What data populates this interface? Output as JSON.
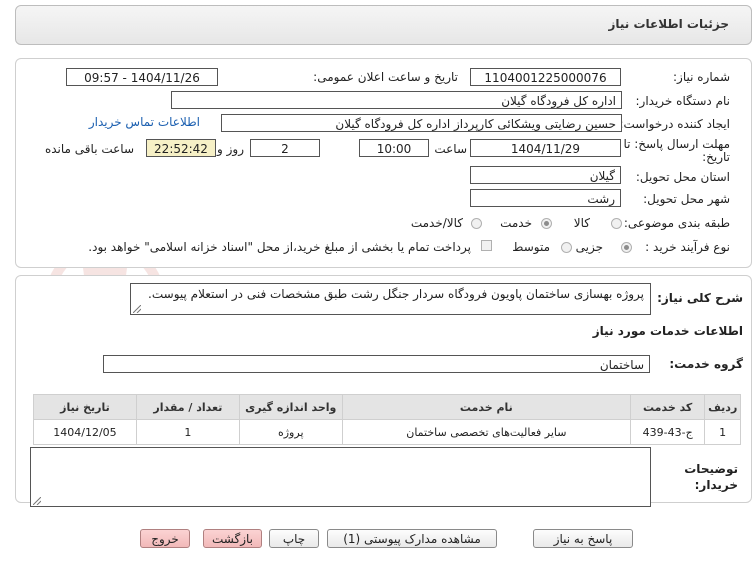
{
  "header": {
    "title": "جزئیات اطلاعات نیاز"
  },
  "watermark": {
    "text": "AriaTender.net"
  },
  "fields": {
    "need_number_label": "شماره نیاز:",
    "need_number": "1104001225000076",
    "announce_label": "تاریخ و ساعت اعلان عمومی:",
    "announce_value": "1404/11/26 - 09:57",
    "buyer_org_label": "نام دستگاه خریدار:",
    "buyer_org": "اداره کل فرودگاه گیلان",
    "creator_label": "ایجاد کننده درخواست:",
    "creator": "حسین رضایتی ویشکائی کارپرداز اداره کل فرودگاه گیلان",
    "contact_link": "اطلاعات تماس خریدار",
    "deadline_label_1": "مهلت ارسال پاسخ: تا",
    "deadline_label_2": "تاریخ:",
    "deadline_date": "1404/11/29",
    "time_label": "ساعت",
    "deadline_time": "10:00",
    "days_value": "2",
    "days_label": "روز و",
    "remaining_time": "22:52:42",
    "remaining_label": "ساعت باقی مانده",
    "province_label": "استان محل تحویل:",
    "province": "گیلان",
    "city_label": "شهر محل تحویل:",
    "city": "رشت",
    "category_label": "طبقه بندی موضوعی:",
    "category_options": [
      "کالا",
      "خدمت",
      "کالا/خدمت"
    ],
    "category_selected": "خدمت",
    "process_label": "نوع فرآیند خرید :",
    "process_options": [
      "جزیی",
      "متوسط"
    ],
    "process_selected": "جزیی",
    "payment_note": "پرداخت تمام یا بخشی از مبلغ خرید،از محل \"اسناد خزانه اسلامی\" خواهد بود."
  },
  "description": {
    "label": "شرح کلی نیاز:",
    "text": "پروژه بهسازی ساختمان پاویون فرودگاه سردار جنگل رشت طبق مشخصات فنی در استعلام پیوست."
  },
  "services": {
    "section_title": "اطلاعات خدمات مورد نیاز",
    "group_label": "گروه خدمت:",
    "group_value": "ساختمان",
    "columns": [
      "ردیف",
      "کد خدمت",
      "نام خدمت",
      "واحد اندازه گیری",
      "تعداد / مقدار",
      "تاریخ نیاز"
    ],
    "rows": [
      [
        "1",
        "ج-43-439",
        "سایر فعالیت‌های تخصصی ساختمان",
        "پروژه",
        "1",
        "1404/12/05"
      ]
    ]
  },
  "buyer_notes": {
    "label_1": "توضیحات",
    "label_2": "خریدار:",
    "text": ""
  },
  "buttons": {
    "reply": "پاسخ به نیاز",
    "attachments": "مشاهده مدارک پیوستی (1)",
    "print": "چاپ",
    "back": "بازگشت",
    "exit": "خروج"
  },
  "colors": {
    "yellow_box": "#f6f0c6",
    "link": "#1b5fb0",
    "pink_button": "#f2b9b9"
  }
}
